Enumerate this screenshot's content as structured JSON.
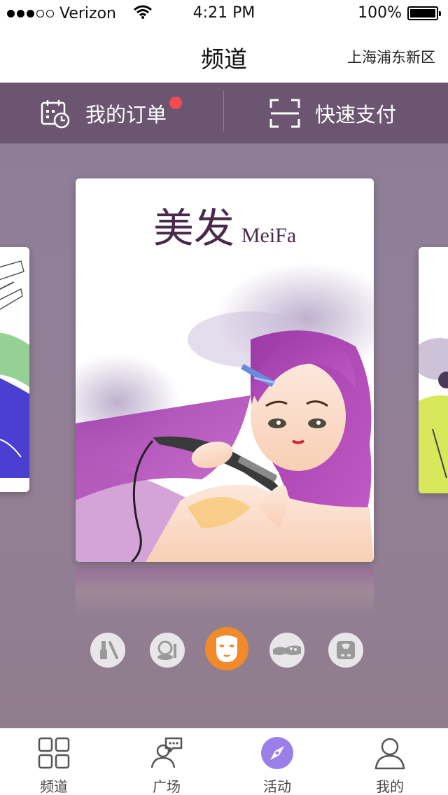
{
  "status_bar": {
    "carrier": "Verizon",
    "time": "4:21 PM",
    "battery": "100%"
  },
  "nav": {
    "title": "频道",
    "location": "上海浦东新区"
  },
  "actions": {
    "orders_label": "我的订单",
    "pay_label": "快速支付"
  },
  "card": {
    "title_zh": "美发",
    "title_en": "MeiFa"
  },
  "categories": [
    {
      "icon": "nail-polish-icon",
      "active": false
    },
    {
      "icon": "compact-mirror-icon",
      "active": false
    },
    {
      "icon": "face-mask-icon",
      "active": true
    },
    {
      "icon": "foot-massage-icon",
      "active": false
    },
    {
      "icon": "weight-scale-icon",
      "active": false
    }
  ],
  "tabs": [
    {
      "label": "频道",
      "icon": "grid-icon"
    },
    {
      "label": "广场",
      "icon": "chat-user-icon"
    },
    {
      "label": "活动",
      "icon": "compass-icon",
      "active": true
    },
    {
      "label": "我的",
      "icon": "person-icon"
    }
  ],
  "colors": {
    "action_bar": "#6b5570",
    "badge": "#f34c50",
    "active_category": "#f08a2a",
    "active_tab": "#9b7fe8",
    "hair_purple": "#a63fb0"
  }
}
